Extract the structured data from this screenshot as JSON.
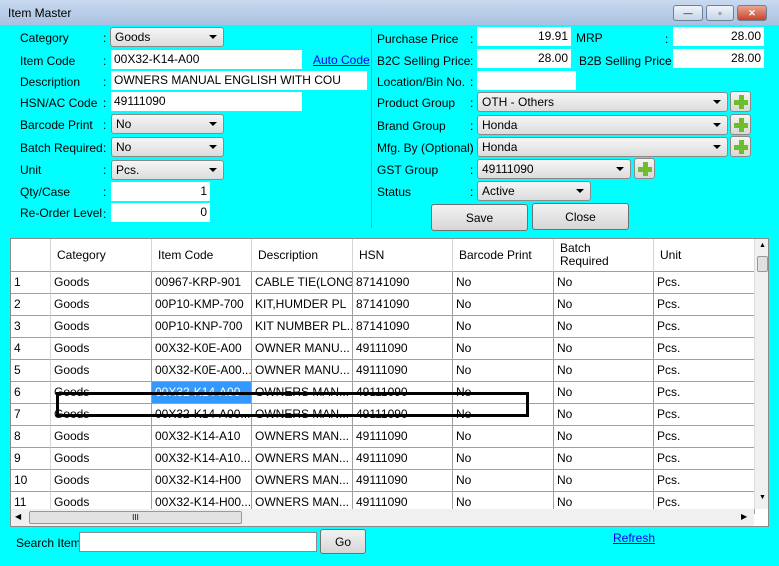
{
  "window": {
    "title": "Item Master",
    "minimize": "—",
    "maximize": "▫",
    "close": "✕"
  },
  "form": {
    "category": {
      "label": "Category",
      "value": "Goods"
    },
    "item_code": {
      "label": "Item Code",
      "value": "00X32-K14-A00",
      "auto_code": "Auto Code"
    },
    "description": {
      "label": "Description",
      "value": "OWNERS MANUAL ENGLISH WITH COU"
    },
    "hsn": {
      "label": "HSN/AC Code",
      "value": "49111090"
    },
    "barcode_print": {
      "label": "Barcode Print",
      "value": "No"
    },
    "batch_required": {
      "label": "Batch Required",
      "value": "No"
    },
    "unit": {
      "label": "Unit",
      "value": "Pcs."
    },
    "qty_case": {
      "label": "Qty/Case",
      "value": "1"
    },
    "reorder_level": {
      "label": "Re-Order Level",
      "value": "0"
    },
    "purchase_price": {
      "label": "Purchase Price",
      "value": "19.91"
    },
    "mrp": {
      "label": "MRP",
      "value": "28.00"
    },
    "b2c_price": {
      "label": "B2C Selling Price",
      "value": "28.00"
    },
    "b2b_price": {
      "label": "B2B Selling Price",
      "value": "28.00"
    },
    "location": {
      "label": "Location/Bin No.",
      "value": ""
    },
    "product_group": {
      "label": "Product Group",
      "value": "OTH - Others"
    },
    "brand_group": {
      "label": "Brand Group",
      "value": "Honda"
    },
    "mfg_by": {
      "label": "Mfg. By (Optional)",
      "value": "Honda"
    },
    "gst_group": {
      "label": "GST Group",
      "value": "49111090"
    },
    "status": {
      "label": "Status",
      "value": "Active"
    },
    "colon": ":",
    "save": "Save",
    "close": "Close"
  },
  "grid": {
    "columns": [
      "Category",
      "Item Code",
      "Description",
      "HSN",
      "Barcode Print",
      "Batch\nRequired",
      "Unit"
    ],
    "rows": [
      [
        "1",
        "Goods",
        "00967-KRP-901",
        "CABLE TIE(LONG)",
        "87141090",
        "No",
        "No",
        "Pcs."
      ],
      [
        "2",
        "Goods",
        "00P10-KMP-700",
        "KIT,HUMDER PL",
        "87141090",
        "No",
        "No",
        "Pcs."
      ],
      [
        "3",
        "Goods",
        "00P10-KNP-700",
        "KIT NUMBER PL...",
        "87141090",
        "No",
        "No",
        "Pcs."
      ],
      [
        "4",
        "Goods",
        "00X32-K0E-A00",
        "OWNER MANU...",
        "49111090",
        "No",
        "No",
        "Pcs."
      ],
      [
        "5",
        "Goods",
        "00X32-K0E-A00...",
        "OWNER MANU...",
        "49111090",
        "No",
        "No",
        "Pcs."
      ],
      [
        "6",
        "Goods",
        "00X32-K14-A00",
        "OWNERS MAN...",
        "49111090",
        "No",
        "No",
        "Pcs."
      ],
      [
        "7",
        "Goods",
        "00X32-K14-A00...",
        "OWNERS MAN...",
        "49111090",
        "No",
        "No",
        "Pcs."
      ],
      [
        "8",
        "Goods",
        "00X32-K14-A10",
        "OWNERS MAN...",
        "49111090",
        "No",
        "No",
        "Pcs."
      ],
      [
        "9",
        "Goods",
        "00X32-K14-A10...",
        "OWNERS MAN...",
        "49111090",
        "No",
        "No",
        "Pcs."
      ],
      [
        "10",
        "Goods",
        "00X32-K14-H00",
        "OWNERS MAN...",
        "49111090",
        "No",
        "No",
        "Pcs."
      ],
      [
        "11",
        "Goods",
        "00X32-K14-H00...",
        "OWNERS MAN...",
        "49111090",
        "No",
        "No",
        "Pcs."
      ]
    ],
    "selected_row": 6,
    "hscroll_grip": "III"
  },
  "search": {
    "label": "Search Item:",
    "value": "",
    "go": "Go",
    "refresh": "Refresh"
  },
  "colors": {
    "background": "#00ffff",
    "selection": "#3399ff",
    "add_icon": "#6cbf2a"
  }
}
